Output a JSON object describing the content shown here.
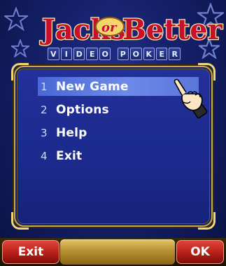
{
  "title": {
    "word_left": "Jacks",
    "word_mid": "or",
    "word_right": "Better",
    "subtitle_letters": [
      "V",
      "I",
      "D",
      "E",
      "O",
      "",
      "P",
      "O",
      "K",
      "E",
      "R"
    ]
  },
  "menu": {
    "items": [
      {
        "num": "1",
        "label": "New Game"
      },
      {
        "num": "2",
        "label": "Options"
      },
      {
        "num": "3",
        "label": "Help"
      },
      {
        "num": "4",
        "label": "Exit"
      }
    ],
    "selected_index": 0
  },
  "softkeys": {
    "left": "Exit",
    "right": "OK"
  },
  "colors": {
    "background": "#15206a",
    "panel": "#1b2a8c",
    "gold": "#c9a84a",
    "selected": "#5a76dc",
    "softkey_red": "#b51f18",
    "title_red": "#c8102e"
  }
}
